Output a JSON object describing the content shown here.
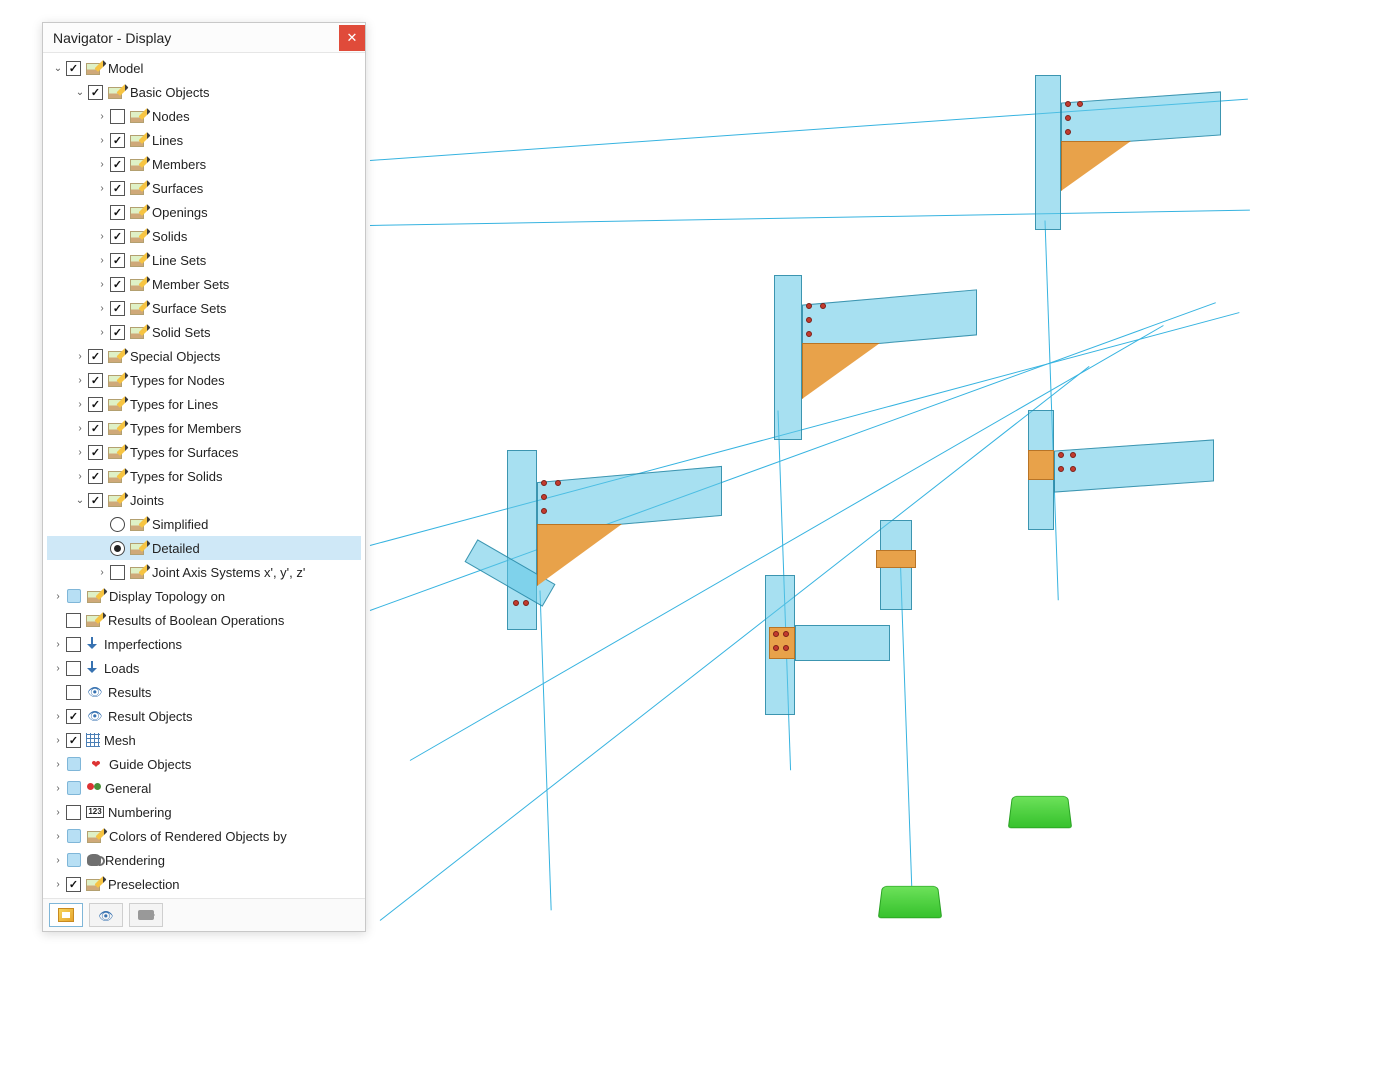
{
  "panel": {
    "title": "Navigator - Display"
  },
  "tree": {
    "model": "Model",
    "basic_objects": "Basic Objects",
    "nodes": "Nodes",
    "lines": "Lines",
    "members": "Members",
    "surfaces": "Surfaces",
    "openings": "Openings",
    "solids": "Solids",
    "line_sets": "Line Sets",
    "member_sets": "Member Sets",
    "surface_sets": "Surface Sets",
    "solid_sets": "Solid Sets",
    "special_objects": "Special Objects",
    "types_for_nodes": "Types for Nodes",
    "types_for_lines": "Types for Lines",
    "types_for_members": "Types for Members",
    "types_for_surfaces": "Types for Surfaces",
    "types_for_solids": "Types for Solids",
    "joints": "Joints",
    "simplified": "Simplified",
    "detailed": "Detailed",
    "joint_axis": "Joint Axis Systems x', y', z'",
    "display_topology": "Display Topology on",
    "boolean_results": "Results of Boolean Operations",
    "imperfections": "Imperfections",
    "loads": "Loads",
    "results": "Results",
    "result_objects": "Result Objects",
    "mesh": "Mesh",
    "guide_objects": "Guide Objects",
    "general": "General",
    "numbering": "Numbering",
    "colors": "Colors of Rendered Objects by",
    "rendering": "Rendering",
    "preselection": "Preselection"
  },
  "numbering_badge": "123"
}
